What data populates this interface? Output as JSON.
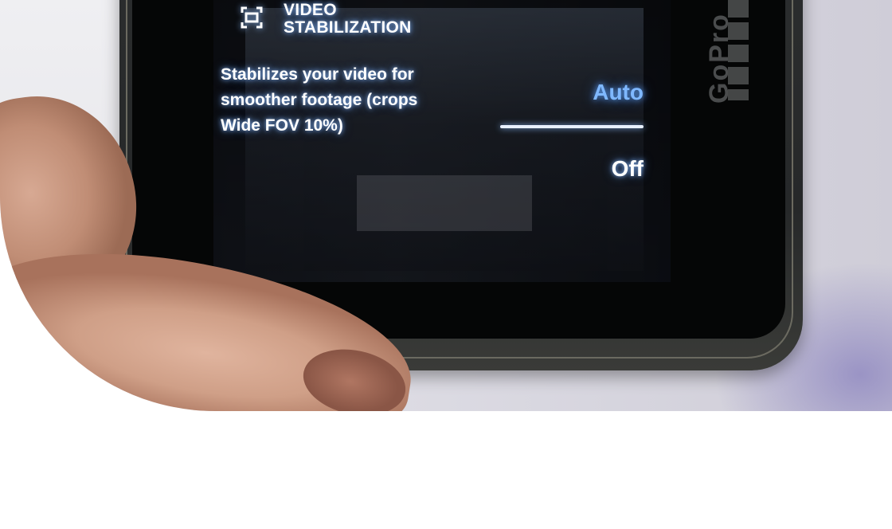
{
  "screen": {
    "setting_title_line1": "VIDEO",
    "setting_title_line2": "STABILIZATION",
    "description_lines": [
      "Stabilizes your video for",
      "smoother footage (crops",
      "Wide FOV 10%)"
    ],
    "options": [
      {
        "label": "Auto",
        "selected": true
      },
      {
        "label": "Off",
        "selected": false
      }
    ]
  },
  "colors": {
    "selected_option": "#7fb8ff",
    "text": "#ffffff",
    "screen_background": "#151820"
  },
  "icons": {
    "setting_icon": "stabilization-icon"
  },
  "brand": "GoPro"
}
